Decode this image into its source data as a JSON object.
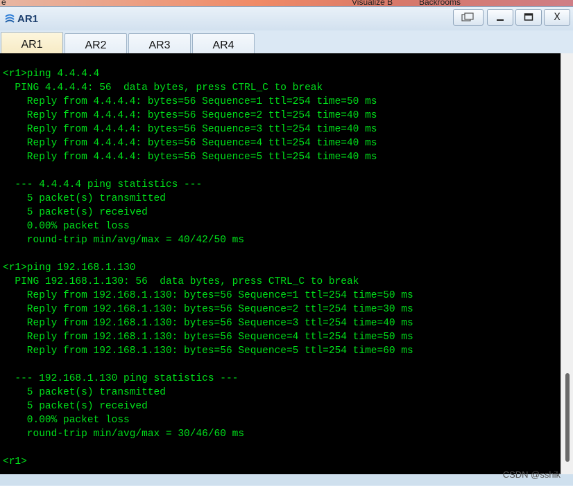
{
  "desktop": {
    "left_text": "e",
    "middle_text": "Visualize B",
    "right_text": "Backrooms"
  },
  "window": {
    "title": "AR1",
    "controls": {
      "restore": "",
      "minimize": "",
      "maximize": "",
      "close": "X"
    }
  },
  "tabs": [
    {
      "label": "AR1",
      "active": true
    },
    {
      "label": "AR2",
      "active": false
    },
    {
      "label": "AR3",
      "active": false
    },
    {
      "label": "AR4",
      "active": false
    }
  ],
  "terminal": {
    "text_color": "#00e01a",
    "lines": [
      "<r1>ping 4.4.4.4",
      "  PING 4.4.4.4: 56  data bytes, press CTRL_C to break",
      "    Reply from 4.4.4.4: bytes=56 Sequence=1 ttl=254 time=50 ms",
      "    Reply from 4.4.4.4: bytes=56 Sequence=2 ttl=254 time=40 ms",
      "    Reply from 4.4.4.4: bytes=56 Sequence=3 ttl=254 time=40 ms",
      "    Reply from 4.4.4.4: bytes=56 Sequence=4 ttl=254 time=40 ms",
      "    Reply from 4.4.4.4: bytes=56 Sequence=5 ttl=254 time=40 ms",
      "",
      "  --- 4.4.4.4 ping statistics ---",
      "    5 packet(s) transmitted",
      "    5 packet(s) received",
      "    0.00% packet loss",
      "    round-trip min/avg/max = 40/42/50 ms",
      "",
      "<r1>ping 192.168.1.130",
      "  PING 192.168.1.130: 56  data bytes, press CTRL_C to break",
      "    Reply from 192.168.1.130: bytes=56 Sequence=1 ttl=254 time=50 ms",
      "    Reply from 192.168.1.130: bytes=56 Sequence=2 ttl=254 time=30 ms",
      "    Reply from 192.168.1.130: bytes=56 Sequence=3 ttl=254 time=40 ms",
      "    Reply from 192.168.1.130: bytes=56 Sequence=4 ttl=254 time=50 ms",
      "    Reply from 192.168.1.130: bytes=56 Sequence=5 ttl=254 time=60 ms",
      "",
      "  --- 192.168.1.130 ping statistics ---",
      "    5 packet(s) transmitted",
      "    5 packet(s) received",
      "    0.00% packet loss",
      "    round-trip min/avg/max = 30/46/60 ms",
      "",
      "<r1>"
    ]
  },
  "watermark": "CSDN @sshik"
}
